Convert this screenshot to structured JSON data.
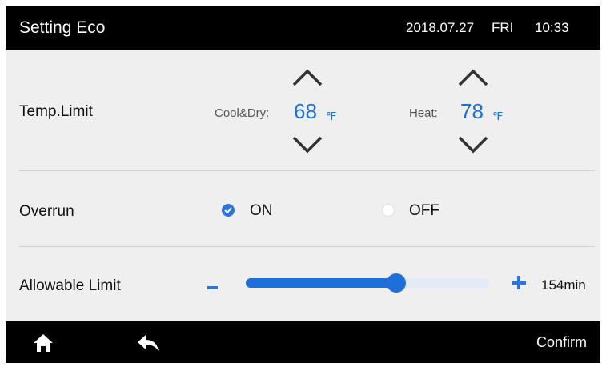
{
  "header": {
    "title": "Setting Eco",
    "date": "2018.07.27",
    "day": "FRI",
    "time": "10:33"
  },
  "temp_limit": {
    "label": "Temp.Limit",
    "cool_label": "Cool&Dry:",
    "cool_value": "68",
    "heat_label": "Heat:",
    "heat_value": "78",
    "unit": "℉"
  },
  "overrun": {
    "label": "Overrun",
    "on_label": "ON",
    "off_label": "OFF",
    "selected": "ON"
  },
  "allowable_limit": {
    "label": "Allowable Limit",
    "value_text": "154min",
    "slider_fraction": 0.62
  },
  "footer": {
    "confirm_label": "Confirm"
  },
  "colors": {
    "accent": "#1e6fd9",
    "bar": "#000000",
    "background": "#efefef"
  },
  "icons": [
    "chevron-up-icon",
    "chevron-down-icon",
    "check-icon",
    "home-icon",
    "back-arrow-icon"
  ]
}
